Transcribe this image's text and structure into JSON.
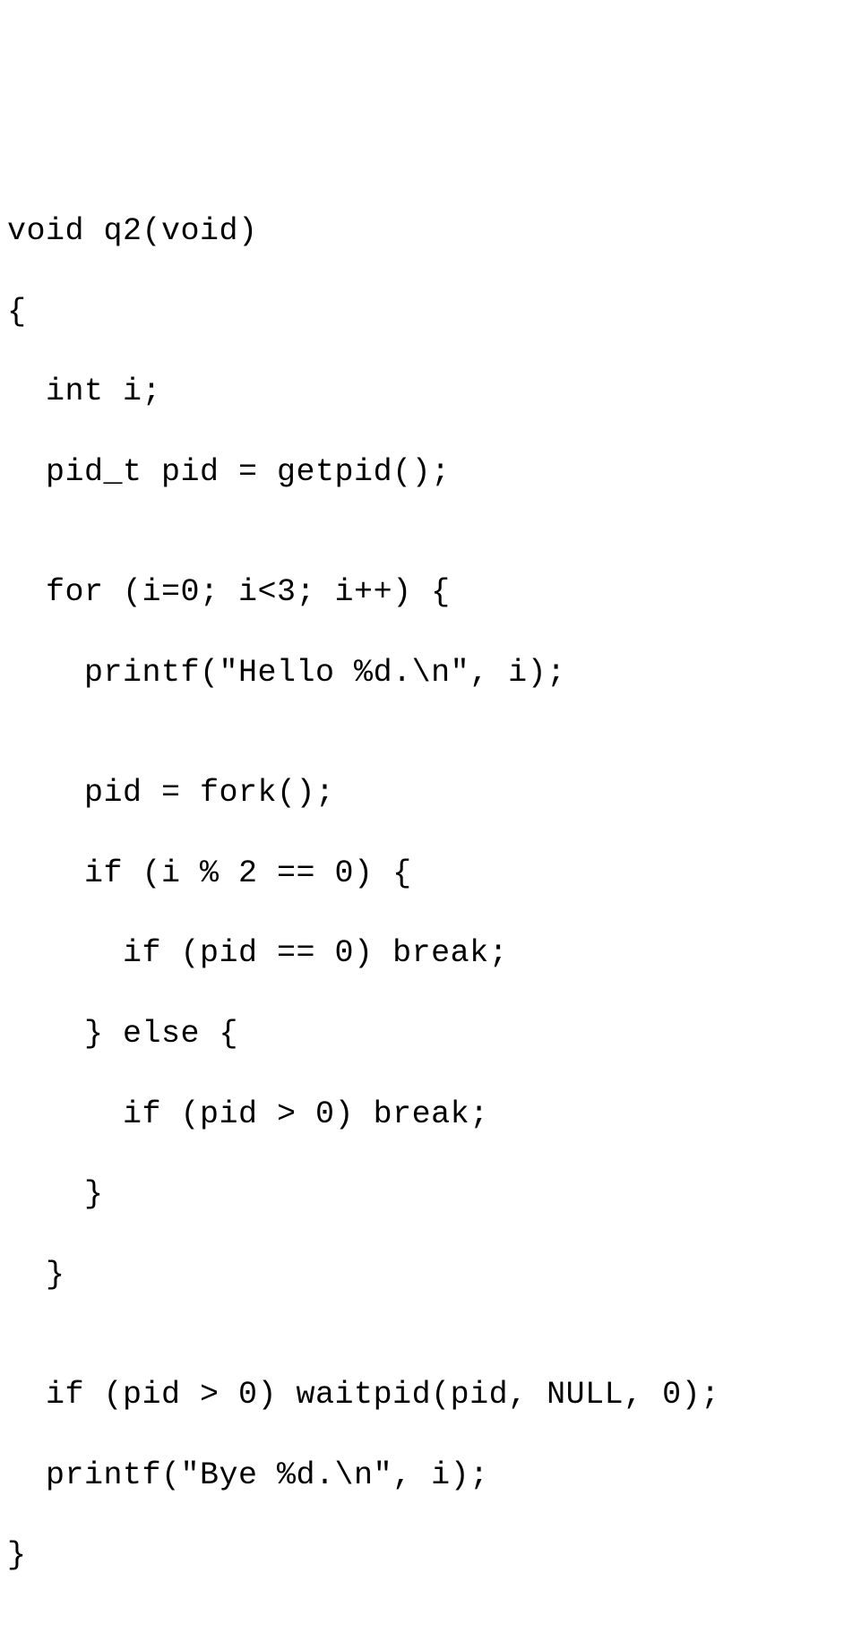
{
  "code": {
    "lines": [
      "void q2(void)",
      "{",
      "  int i;",
      "  pid_t pid = getpid();",
      "",
      "  for (i=0; i<3; i++) {",
      "    printf(\"Hello %d.\\n\", i);",
      "",
      "    pid = fork();",
      "    if (i % 2 == 0) {",
      "      if (pid == 0) break;",
      "    } else {",
      "      if (pid > 0) break;",
      "    }",
      "  }",
      "",
      "  if (pid > 0) waitpid(pid, NULL, 0);",
      "  printf(\"Bye %d.\\n\", i);",
      "}"
    ]
  }
}
